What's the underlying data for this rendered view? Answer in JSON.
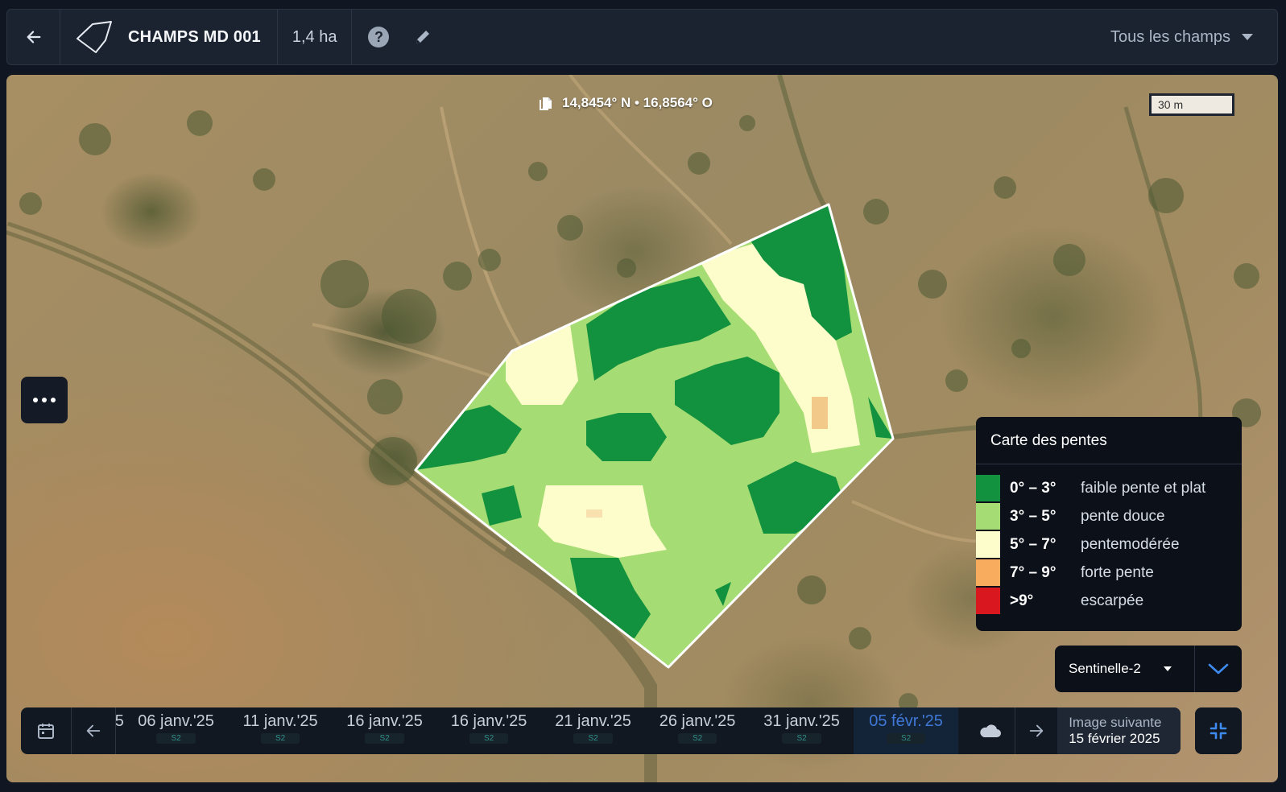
{
  "header": {
    "field_name": "CHAMPS MD 001",
    "area": "1,4 ha",
    "help_symbol": "?",
    "all_fields_label": "Tous les champs"
  },
  "map": {
    "coordinates": "14,8454° N  •  16,8564° O",
    "scale": "30 m"
  },
  "legend": {
    "title": "Carte des pentes",
    "items": [
      {
        "range": "0° – 3°",
        "label": "faible pente et plat",
        "color": "#12923e"
      },
      {
        "range": "3° – 5°",
        "label": "pente douce",
        "color": "#a6dc74"
      },
      {
        "range": "5° – 7°",
        "label": "pentemodérée",
        "color": "#fdfccb"
      },
      {
        "range": "7° – 9°",
        "label": "forte pente",
        "color": "#f8ac5e"
      },
      {
        "range": ">9°",
        "label": "escarpée",
        "color": "#d9171e"
      }
    ]
  },
  "source_selector": {
    "selected": "Sentinelle-2"
  },
  "timeline": {
    "partial_first": "5",
    "dates": [
      {
        "label": "06 janv.'25",
        "source": "S2"
      },
      {
        "label": "11 janv.'25",
        "source": "S2"
      },
      {
        "label": "16 janv.'25",
        "source": "S2"
      },
      {
        "label": "16 janv.'25",
        "source": "S2"
      },
      {
        "label": "21 janv.'25",
        "source": "S2"
      },
      {
        "label": "26 janv.'25",
        "source": "S2"
      },
      {
        "label": "31 janv.'25",
        "source": "S2"
      },
      {
        "label": "05 févr.'25",
        "source": "S2"
      }
    ],
    "active_date": "05 févr.'25",
    "next_image_title": "Image suivante",
    "next_image_date": "15 février 2025"
  },
  "colors": {
    "header_bg": "#1b2330",
    "active_date": "#3f78d6",
    "accent_blue": "#3d8bf0"
  }
}
